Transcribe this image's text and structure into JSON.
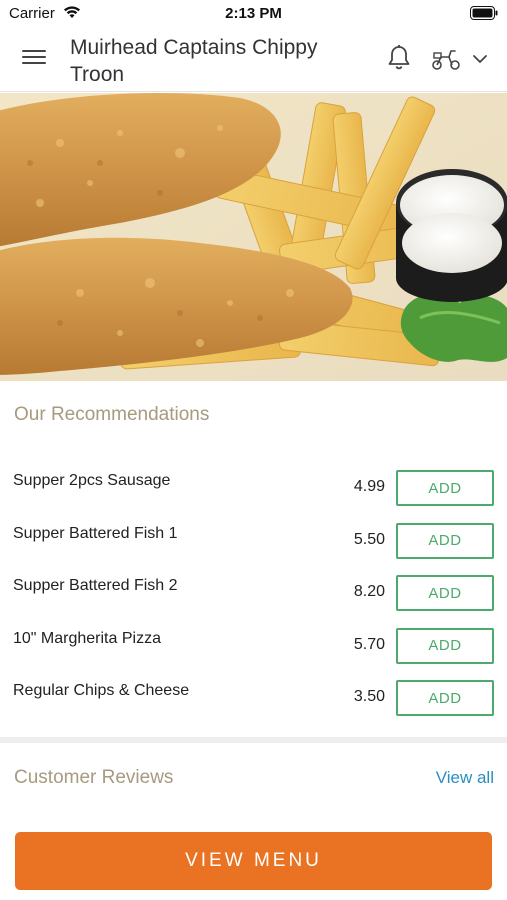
{
  "status_bar": {
    "carrier": "Carrier",
    "time": "2:13 PM",
    "icons": [
      "wifi-icon",
      "battery-icon"
    ]
  },
  "header": {
    "title": "Muirhead Captains Chippy Troon",
    "icons": [
      "menu-icon",
      "bell-icon",
      "delivery-scooter-icon",
      "chevron-down-icon"
    ]
  },
  "hero": {
    "image": "fish-and-chips-photo"
  },
  "recommendations": {
    "title": "Our Recommendations",
    "add_label": "ADD",
    "items": [
      {
        "name": "Supper 2pcs Sausage",
        "price": "4.99"
      },
      {
        "name": "Supper Battered Fish 1",
        "price": "5.50"
      },
      {
        "name": "Supper Battered Fish 2",
        "price": "8.20"
      },
      {
        "name": "10\" Margherita Pizza",
        "price": "5.70"
      },
      {
        "name": "Regular Chips & Cheese",
        "price": "3.50"
      }
    ]
  },
  "reviews": {
    "title": "Customer Reviews",
    "view_all": "View all"
  },
  "footer": {
    "view_menu": "VIEW MENU"
  },
  "colors": {
    "accent_orange": "#e97322",
    "add_green": "#4caa6c",
    "section_title": "#a79a7e",
    "link_blue": "#2a8fbf"
  }
}
